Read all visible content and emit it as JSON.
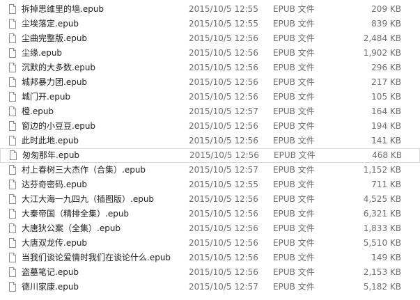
{
  "files": [
    {
      "name": "拆掉思维里的墙.epub",
      "date": "2015/10/5 12:55",
      "type": "EPUB 文件",
      "size": "209 KB"
    },
    {
      "name": "尘埃落定.epub",
      "date": "2015/10/5 12:55",
      "type": "EPUB 文件",
      "size": "839 KB"
    },
    {
      "name": "尘曲完整版.epub",
      "date": "2015/10/5 12:56",
      "type": "EPUB 文件",
      "size": "2,484 KB"
    },
    {
      "name": "尘缘.epub",
      "date": "2015/10/5 12:56",
      "type": "EPUB 文件",
      "size": "1,902 KB"
    },
    {
      "name": "沉默的大多数.epub",
      "date": "2015/10/5 12:56",
      "type": "EPUB 文件",
      "size": "296 KB"
    },
    {
      "name": "城邦暴力团.epub",
      "date": "2015/10/5 12:56",
      "type": "EPUB 文件",
      "size": "217 KB"
    },
    {
      "name": "城门开.epub",
      "date": "2015/10/5 12:56",
      "type": "EPUB 文件",
      "size": "105 KB"
    },
    {
      "name": "橙.epub",
      "date": "2015/10/5 12:57",
      "type": "EPUB 文件",
      "size": "164 KB"
    },
    {
      "name": "窗边的小豆豆.epub",
      "date": "2015/10/5 12:56",
      "type": "EPUB 文件",
      "size": "194 KB"
    },
    {
      "name": "此时此地.epub",
      "date": "2015/10/5 12:56",
      "type": "EPUB 文件",
      "size": "141 KB"
    },
    {
      "name": "匆匆那年.epub",
      "date": "2015/10/5 12:56",
      "type": "EPUB 文件",
      "size": "468 KB"
    },
    {
      "name": "村上春树三大杰作（合集）.epub",
      "date": "2015/10/5 12:57",
      "type": "EPUB 文件",
      "size": "1,152 KB"
    },
    {
      "name": "达芬奇密码.epub",
      "date": "2015/10/5 12:55",
      "type": "EPUB 文件",
      "size": "711 KB"
    },
    {
      "name": "大江大海一九四九（插图版）.epub",
      "date": "2015/10/5 12:56",
      "type": "EPUB 文件",
      "size": "4,525 KB"
    },
    {
      "name": "大秦帝国（精排全集）.epub",
      "date": "2015/10/5 12:56",
      "type": "EPUB 文件",
      "size": "6,321 KB"
    },
    {
      "name": "大唐狄公案（全集）.epub",
      "date": "2015/10/5 12:56",
      "type": "EPUB 文件",
      "size": "1,833 KB"
    },
    {
      "name": "大唐双龙传.epub",
      "date": "2015/10/5 12:56",
      "type": "EPUB 文件",
      "size": "5,510 KB"
    },
    {
      "name": "当我们谈论爱情时我们在谈论什么.epub",
      "date": "2015/10/5 12:56",
      "type": "EPUB 文件",
      "size": "149 KB"
    },
    {
      "name": "盗墓笔记.epub",
      "date": "2015/10/5 12:56",
      "type": "EPUB 文件",
      "size": "2,153 KB"
    },
    {
      "name": "德川家康.epub",
      "date": "2015/10/5 12:57",
      "type": "EPUB 文件",
      "size": "5,182 KB"
    }
  ],
  "selected_index": 10,
  "icon": "generic-file-icon",
  "colors": {
    "text": "#1e1e1e",
    "meta_text": "#6d6d6d",
    "selection_border": "#d9d9d9"
  }
}
